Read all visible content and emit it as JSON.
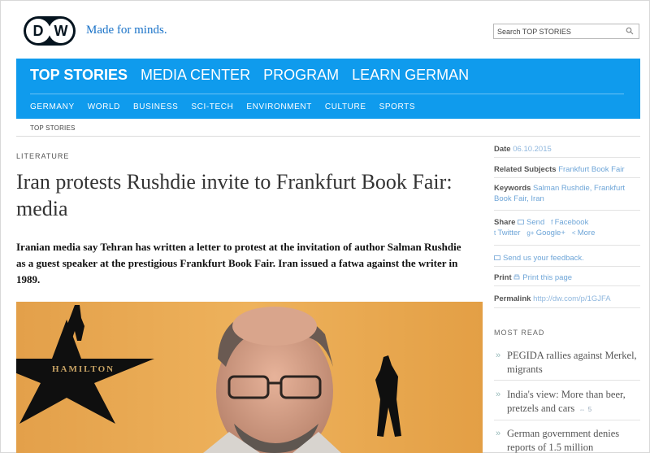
{
  "header": {
    "logo_text": "DW",
    "tagline": "Made for minds.",
    "search_placeholder": "Search TOP STORIES"
  },
  "nav": {
    "main_tabs": [
      "TOP STORIES",
      "MEDIA CENTER",
      "PROGRAM",
      "LEARN GERMAN"
    ],
    "sub_tabs": [
      "GERMANY",
      "WORLD",
      "BUSINESS",
      "SCI-TECH",
      "ENVIRONMENT",
      "CULTURE",
      "SPORTS"
    ]
  },
  "breadcrumb": "TOP STORIES",
  "article": {
    "category": "LITERATURE",
    "headline": "Iran protests Rushdie invite to Frankfurt Book Fair: media",
    "lead": "Iranian media say Tehran has written a letter to protest at the invitation of author Salman Rushdie as a guest speaker at the prestigious Frankfurt Book Fair. Iran issued a fatwa against the writer in 1989.",
    "image_sign_text": "HAMILTON"
  },
  "sidebar": {
    "date_label": "Date",
    "date_value": "06.10.2015",
    "related_label": "Related Subjects",
    "related_value": "Frankfurt Book Fair",
    "keywords_label": "Keywords",
    "keywords_value": "Salman Rushdie, Frankfurt Book Fair, Iran",
    "share_label": "Share",
    "share_send": "Send",
    "share_facebook": "Facebook",
    "share_twitter": "Twitter",
    "share_google": "Google+",
    "share_more": "More",
    "feedback": "Send us your feedback.",
    "print_label": "Print",
    "print_link": "Print this page",
    "permalink_label": "Permalink",
    "permalink_value": "http://dw.com/p/1GJFA",
    "most_read_title": "MOST READ",
    "most_read": [
      "PEGIDA rallies against Merkel, migrants",
      "India's view: More than beer, pretzels and cars",
      "German government denies reports of 1.5 million"
    ],
    "comment_count_2": "5"
  },
  "colors": {
    "nav_blue": "#0f9bed",
    "link_blue": "#1a73c8",
    "logo_dark": "#05141f"
  }
}
